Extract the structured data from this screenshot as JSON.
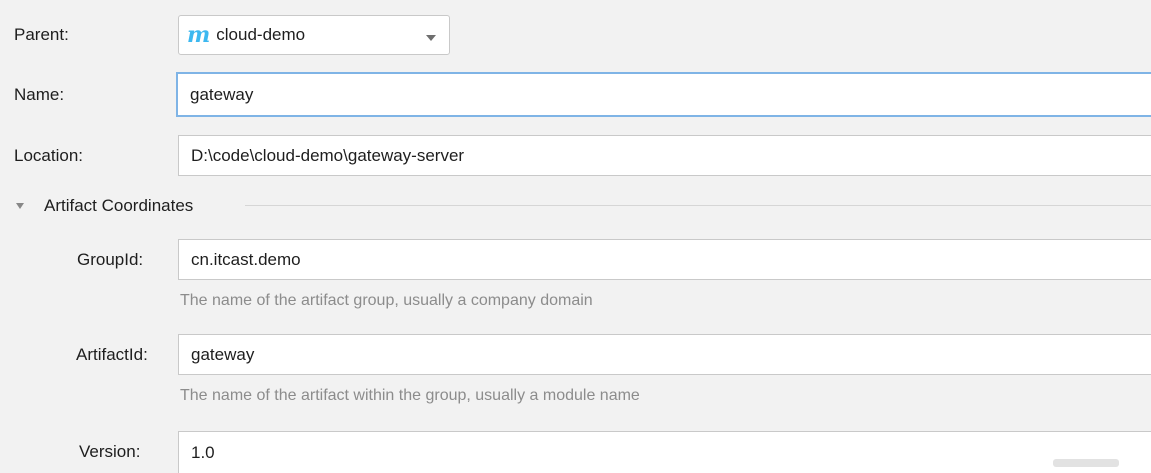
{
  "parent": {
    "label": "Parent:",
    "icon": "maven-m-icon",
    "icon_glyph": "m",
    "icon_color": "#3db8f0",
    "value": "cloud-demo"
  },
  "name": {
    "label": "Name:",
    "value": "gateway"
  },
  "location": {
    "label": "Location:",
    "value": "D:\\code\\cloud-demo\\gateway-server"
  },
  "artifact_section": {
    "title": "Artifact Coordinates",
    "expanded": true
  },
  "group_id": {
    "label": "GroupId:",
    "value": "cn.itcast.demo",
    "hint": "The name of the artifact group, usually a company domain"
  },
  "artifact_id": {
    "label": "ArtifactId:",
    "value": "gateway",
    "hint": "The name of the artifact within the group, usually a module name"
  },
  "version": {
    "label": "Version:",
    "value": "1.0"
  }
}
